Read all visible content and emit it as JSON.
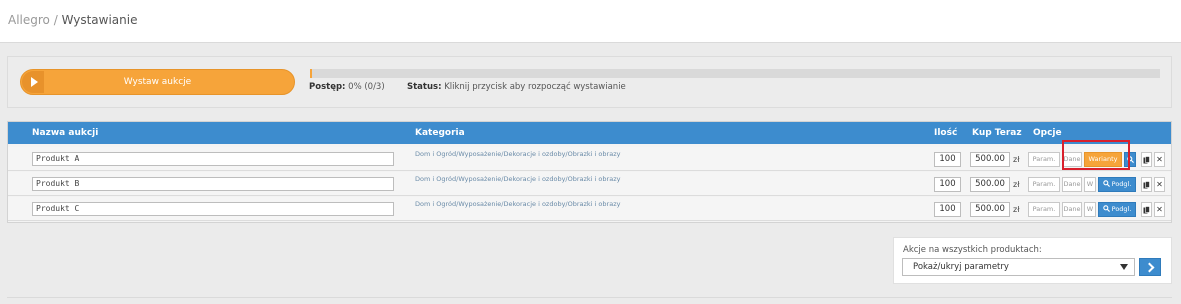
{
  "breadcrumb": {
    "root": "Allegro",
    "separator": " / ",
    "current": "Wystawianie"
  },
  "start": {
    "label": "Wystaw aukcje"
  },
  "progress": {
    "label": "Postęp:",
    "value": "0% (0/3)",
    "fraction": 0
  },
  "status": {
    "label": "Status:",
    "text": "Kliknij przycisk aby rozpocząć wystawianie"
  },
  "table": {
    "headers": {
      "name": "Nazwa aukcji",
      "category": "Kategoria",
      "qty": "Ilość",
      "price": "Kup Teraz",
      "options": "Opcje"
    },
    "rows": [
      {
        "name": "Produkt A",
        "category": "Dom i Ogród/Wyposażenie/Dekoracje i ozdoby/Obrazki i obrazy",
        "qty": "100",
        "price": "500.00",
        "currency": "zł",
        "param": "Param.",
        "dane": "Dane",
        "warianty": "Warianty",
        "preview": ""
      },
      {
        "name": "Produkt B",
        "category": "Dom i Ogród/Wyposażenie/Dekoracje i ozdoby/Obrazki i obrazy",
        "qty": "100",
        "price": "500.00",
        "currency": "zł",
        "param": "Param.",
        "dane": "Dane",
        "warianty": "W",
        "preview": "Podgl."
      },
      {
        "name": "Produkt C",
        "category": "Dom i Ogród/Wyposażenie/Dekoracje i ozdoby/Obrazki i obrazy",
        "qty": "100",
        "price": "500.00",
        "currency": "zł",
        "param": "Param.",
        "dane": "Dane",
        "warianty": "W",
        "preview": "Podgl."
      }
    ],
    "icons": {
      "copy": "copy-icon",
      "remove": "close-icon",
      "search": "search-icon"
    }
  },
  "bulk": {
    "label": "Akcje na wszystkich produktach:",
    "selected": "Pokaż/ukryj parametry"
  },
  "colors": {
    "accent_blue": "#3d8cce",
    "accent_orange": "#f6a43a",
    "highlight_red": "#d9202c"
  }
}
